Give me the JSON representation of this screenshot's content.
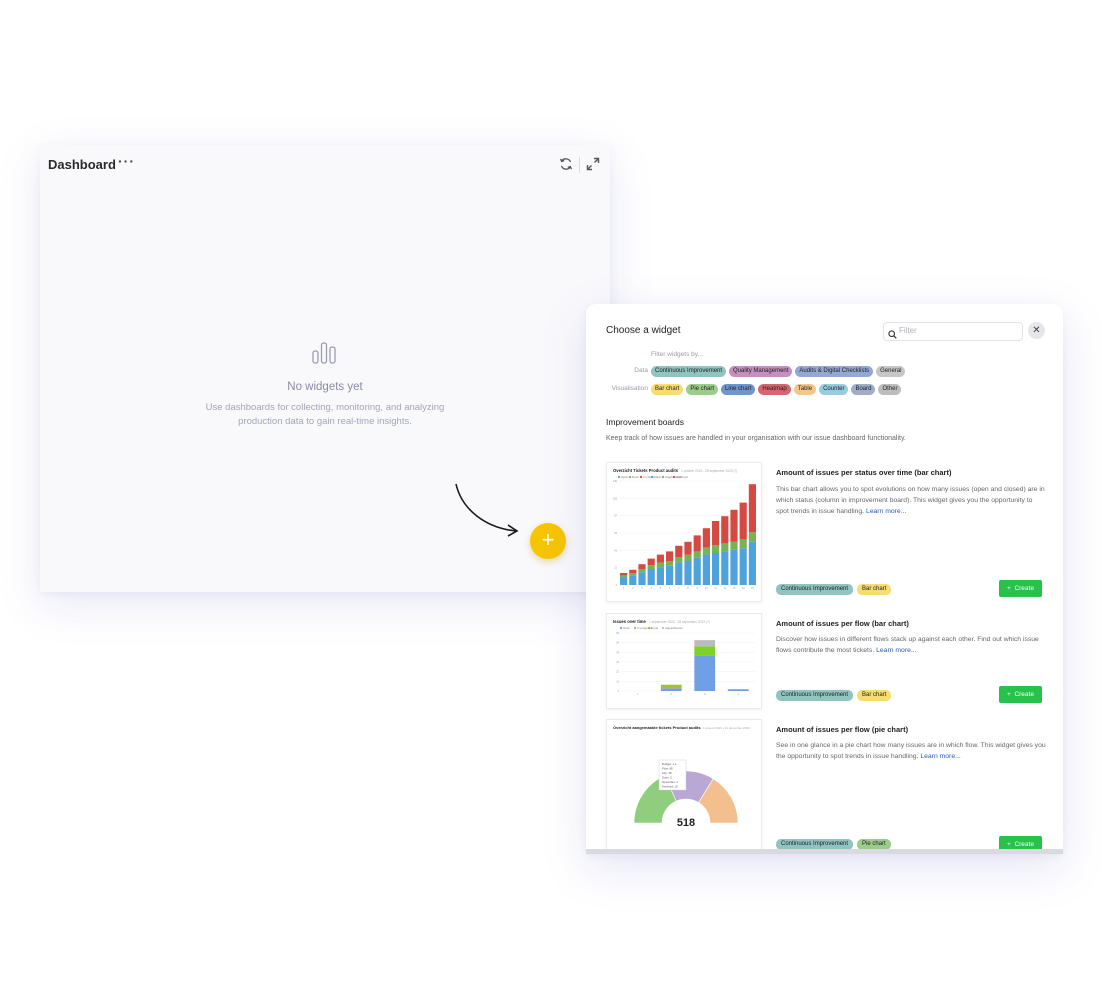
{
  "dashboard": {
    "title": "Dashboard",
    "menu_glyph": "···",
    "refresh_icon": "refresh-icon",
    "expand_icon": "expand-icon",
    "empty_title": "No widgets yet",
    "empty_desc": "Use dashboards for collecting, monitoring, and analyzing production data to gain real-time insights.",
    "add_glyph": "+"
  },
  "modal": {
    "title": "Choose a widget",
    "filter_placeholder": "Filter",
    "close_glyph": "✕",
    "filter_hint": "Filter widgets by...",
    "data_label": "Data",
    "data_chips": [
      {
        "label": "Continuous Improvement",
        "color": "#8fc4c0"
      },
      {
        "label": "Quality Management",
        "color": "#c58fc0"
      },
      {
        "label": "Audits & Digital Checklists",
        "color": "#93a9d4"
      },
      {
        "label": "General",
        "color": "#c6c6c6"
      }
    ],
    "vis_label": "Visualisation",
    "vis_chips": [
      {
        "label": "Bar chart",
        "color": "#f7dc6f"
      },
      {
        "label": "Pie chart",
        "color": "#9ccc8a"
      },
      {
        "label": "Line chart",
        "color": "#6f95cf"
      },
      {
        "label": "Heatmap",
        "color": "#d5656f"
      },
      {
        "label": "Table",
        "color": "#f2c889"
      },
      {
        "label": "Counter",
        "color": "#95cce0"
      },
      {
        "label": "Board",
        "color": "#9fadc9"
      },
      {
        "label": "Other",
        "color": "#bdbdbd"
      }
    ],
    "section_title": "Improvement boards",
    "section_desc": "Keep track of how issues are handled in your organisation with our issue dashboard functionality.",
    "widgets": [
      {
        "title": "Amount of issues per status over time (bar chart)",
        "desc": "This bar chart allows you to spot evolutions on how many issues (open and closed) are in which status (column in improvement board). This widget gives you the opportunity to spot trends in issue handling.",
        "learn": "Learn more...",
        "tags": [
          {
            "label": "Continuous Improvement",
            "color": "#8fc4c0"
          },
          {
            "label": "Bar chart",
            "color": "#f7dc6f"
          }
        ],
        "create": "Create",
        "preview_title": "Overzicht Tickets Product audits",
        "preview_sub": "1 october 2023 - 28 september 2023 (?)",
        "preview_legend": [
          "Open",
          "Doen",
          "In check",
          "Klaar",
          "Afgehandeld",
          "Archived"
        ]
      },
      {
        "title": "Amount of issues per flow (bar chart)",
        "desc": "Discover how issues in different flows stack up against each other. Find out which issue flows contribute the most tickets.",
        "learn": "Learn more...",
        "tags": [
          {
            "label": "Continuous Improvement",
            "color": "#8fc4c0"
          },
          {
            "label": "Bar chart",
            "color": "#f7dc6f"
          }
        ],
        "create": "Create",
        "preview_title": "Issues over time",
        "preview_sub": "1 september 2023 - 28 september 2023 (?)",
        "preview_legend": [
          "Todo",
          "In progress",
          "Done",
          "Ingeschreven"
        ]
      },
      {
        "title": "Amount of issues per flow (pie chart)",
        "desc": "See in one glance in a pie chart how many issues are in which flow. This widget gives you the opportunity to spot trends in issue handling.",
        "learn": "Learn more...",
        "tags": [
          {
            "label": "Continuous Improvement",
            "color": "#8fc4c0"
          },
          {
            "label": "Pie chart",
            "color": "#9ccc8a"
          }
        ],
        "create": "Create",
        "preview_title": "Overzicht aangemaakte tickets Product audits",
        "preview_sub": "1 januari 2023 - 31 december 2023",
        "preview_total": "518",
        "preview_tooltip": [
          "Budget: 1 a",
          "Flow: 68",
          "City: 18",
          "Doen: 2",
          "Gevonden: 1",
          "Archived: 15"
        ]
      }
    ]
  },
  "chart_data": [
    {
      "type": "bar",
      "title": "Overzicht Tickets Product audits",
      "categories": [
        "1",
        "2",
        "3",
        "4",
        "5",
        "6",
        "7",
        "8",
        "9",
        "10",
        "11",
        "12",
        "13",
        "14",
        "15"
      ],
      "series": [
        {
          "name": "Open",
          "color": "#4ea3dc",
          "values": [
            10,
            12,
            16,
            20,
            22,
            24,
            28,
            30,
            34,
            38,
            40,
            42,
            44,
            46,
            54
          ]
        },
        {
          "name": "In check",
          "color": "#77b255",
          "values": [
            2,
            3,
            4,
            5,
            6,
            6,
            7,
            8,
            8,
            9,
            10,
            10,
            10,
            11,
            12
          ]
        },
        {
          "name": "Afgehandeld",
          "color": "#d44a43",
          "values": [
            3,
            4,
            6,
            8,
            10,
            12,
            14,
            16,
            20,
            24,
            30,
            34,
            40,
            46,
            60
          ]
        }
      ],
      "ylim": [
        0,
        130
      ]
    },
    {
      "type": "bar",
      "title": "Issues over time",
      "categories": [
        "1",
        "2",
        "3",
        "4"
      ],
      "series": [
        {
          "name": "Todo",
          "color": "#6fa0e6",
          "values": [
            0,
            3,
            40,
            2
          ]
        },
        {
          "name": "In progress",
          "color": "#e69a5a",
          "values": [
            0,
            2,
            0,
            0
          ]
        },
        {
          "name": "Done",
          "color": "#7ed321",
          "values": [
            0,
            2,
            10,
            0
          ]
        },
        {
          "name": "Ingeschreven",
          "color": "#bbbbbb",
          "values": [
            0,
            0,
            7,
            0
          ]
        }
      ],
      "ylim": [
        0,
        65
      ]
    },
    {
      "type": "pie",
      "title": "Overzicht aangemaakte tickets Product audits",
      "total": 518,
      "slices": [
        {
          "value": 190,
          "color": "#8fce7c"
        },
        {
          "value": 160,
          "color": "#b9a7d6"
        },
        {
          "value": 168,
          "color": "#f4bf8f"
        }
      ]
    }
  ]
}
